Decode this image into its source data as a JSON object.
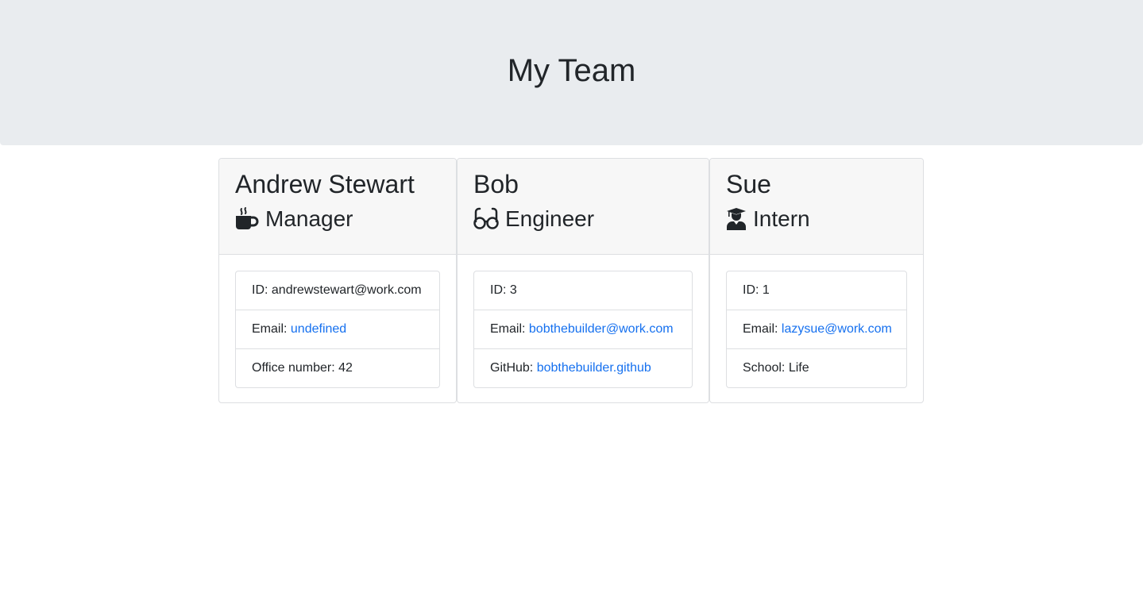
{
  "header": {
    "title": "My Team"
  },
  "team": [
    {
      "name": "Andrew Stewart",
      "role": "Manager",
      "role_icon": "mug-hot-icon",
      "id_label": "ID: ",
      "id_value": "andrewstewart@work.com",
      "email_label": "Email: ",
      "email_value": "undefined",
      "extra_label": "Office number: ",
      "extra_value": "42",
      "extra_is_link": false
    },
    {
      "name": "Bob",
      "role": "Engineer",
      "role_icon": "glasses-icon",
      "id_label": "ID: ",
      "id_value": "3",
      "email_label": "Email: ",
      "email_value": "bobthebuilder@work.com",
      "extra_label": "GitHub: ",
      "extra_value": "bobthebuilder.github",
      "extra_is_link": true
    },
    {
      "name": "Sue",
      "role": "Intern",
      "role_icon": "user-graduate-icon",
      "id_label": "ID: ",
      "id_value": "1",
      "email_label": "Email: ",
      "email_value": "lazysue@work.com",
      "extra_label": "School: ",
      "extra_value": "Life",
      "extra_is_link": false
    }
  ],
  "colors": {
    "header_bg": "#e9ecef",
    "card_header_bg": "#f7f7f7",
    "link": "#1570ef",
    "text": "#212529"
  }
}
